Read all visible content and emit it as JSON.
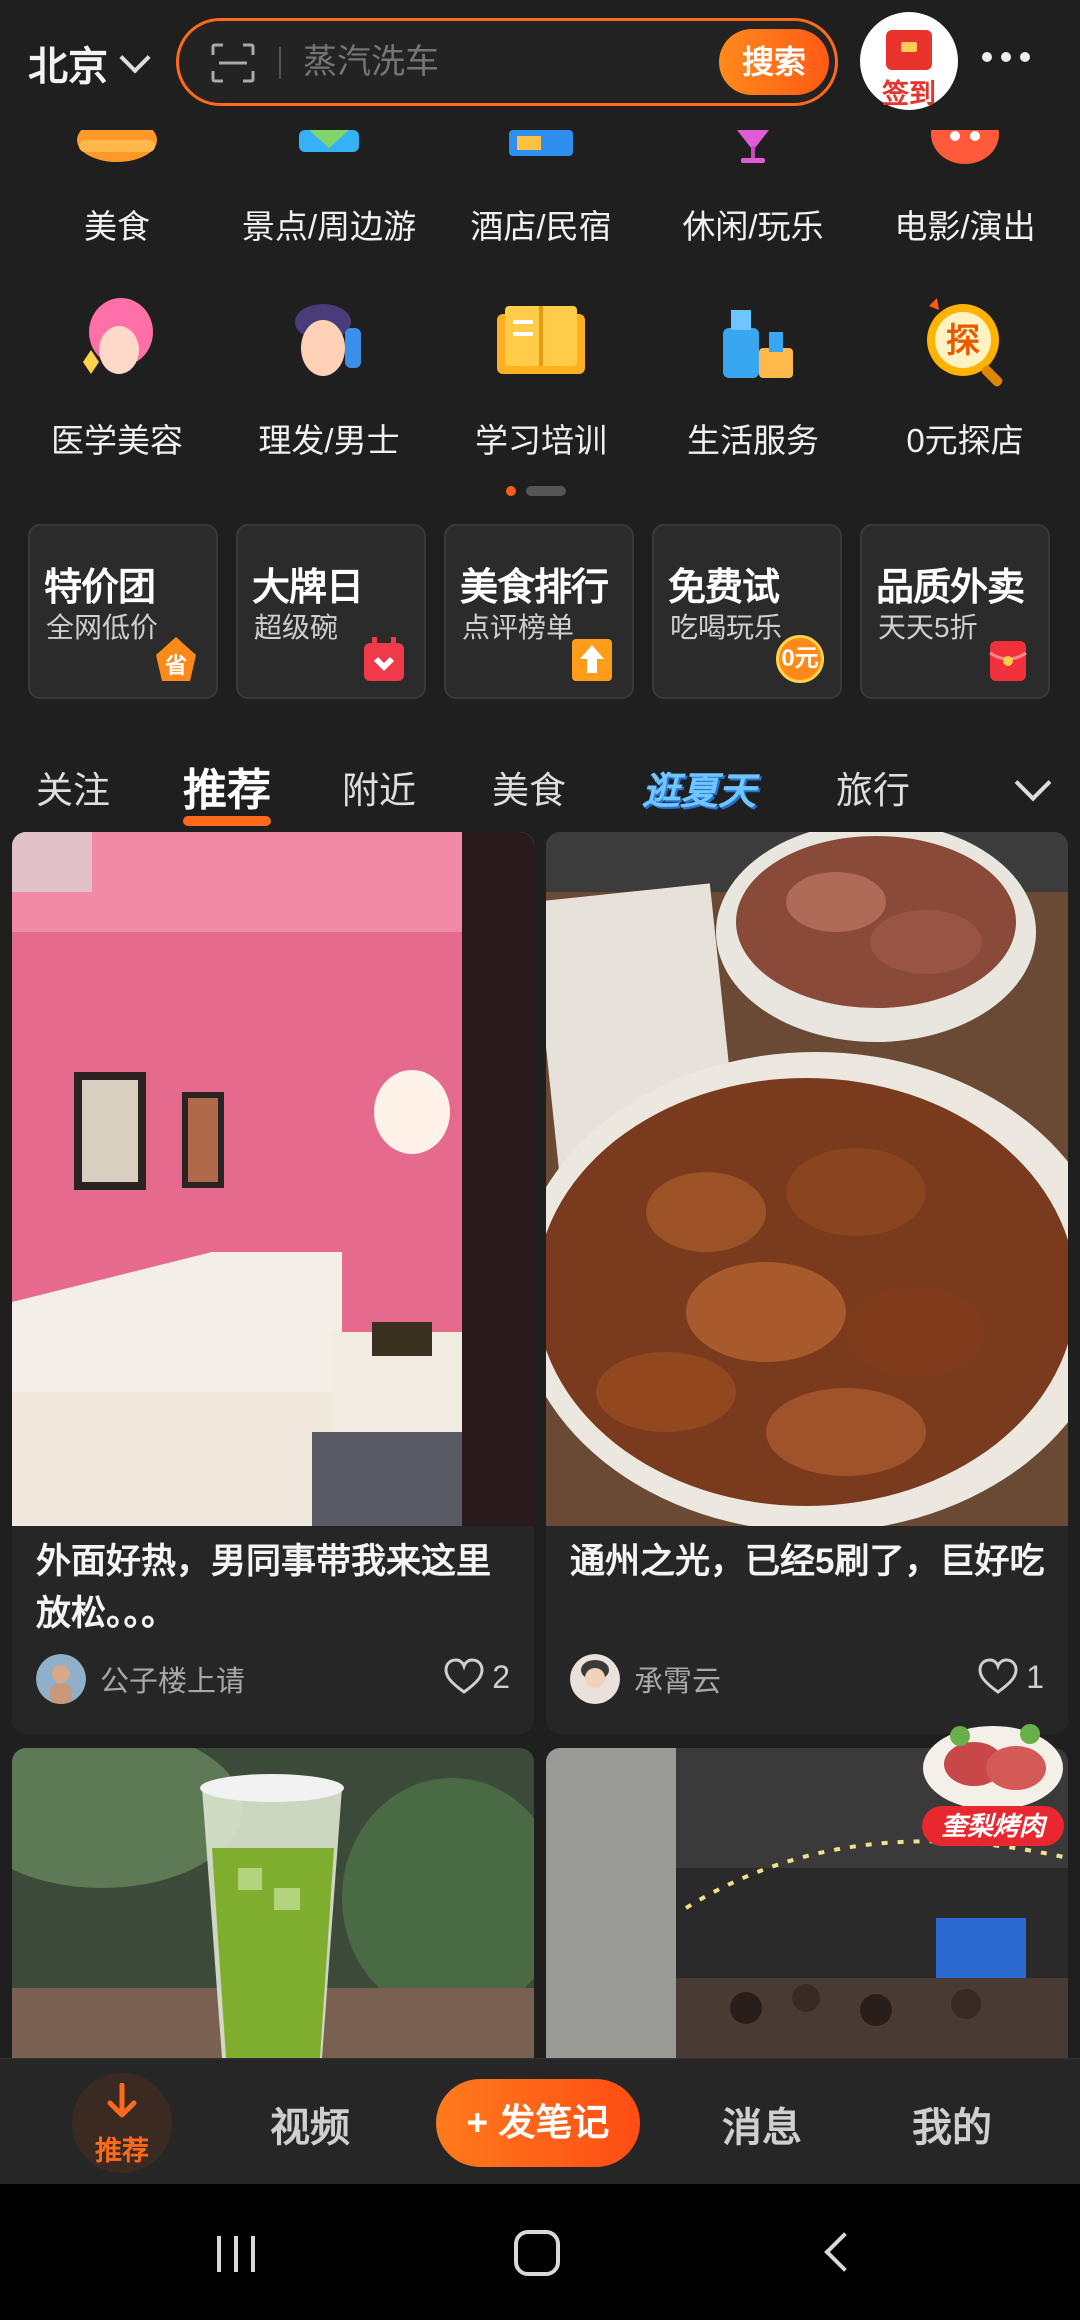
{
  "header": {
    "city": "北京",
    "search_placeholder": "蒸汽洗车",
    "search_button": "搜索",
    "signin_label": "签到"
  },
  "categories": [
    {
      "label": "美食",
      "icon": "roast-chicken-icon"
    },
    {
      "label": "景点/周边游",
      "icon": "scenic-icon"
    },
    {
      "label": "酒店/民宿",
      "icon": "hotel-icon"
    },
    {
      "label": "休闲/玩乐",
      "icon": "cocktail-icon"
    },
    {
      "label": "电影/演出",
      "icon": "movie-icon"
    },
    {
      "label": "医学美容",
      "icon": "beauty-icon"
    },
    {
      "label": "理发/男士",
      "icon": "barber-icon"
    },
    {
      "label": "学习培训",
      "icon": "book-icon"
    },
    {
      "label": "生活服务",
      "icon": "cleaning-icon"
    },
    {
      "label": "0元探店",
      "icon": "explore-icon"
    }
  ],
  "promos": [
    {
      "title": "特价团",
      "subtitle": "全网低价"
    },
    {
      "title": "大牌日",
      "subtitle": "超级碗"
    },
    {
      "title": "美食排行",
      "subtitle": "点评榜单"
    },
    {
      "title": "免费试",
      "subtitle": "吃喝玩乐",
      "badge": "0元"
    },
    {
      "title": "品质外卖",
      "subtitle": "天天5折"
    }
  ],
  "tabs": [
    "关注",
    "推荐",
    "附近",
    "美食",
    "逛夏天",
    "旅行"
  ],
  "active_tab": "推荐",
  "feed": [
    {
      "title": "外面好热，男同事带我来这里放松。。。",
      "author": "公子楼上请",
      "likes": "2"
    },
    {
      "title": "通州之光，已经5刷了，巨好吃",
      "author": "承霄云",
      "likes": "1"
    }
  ],
  "feed_badge": "奎梨烤肉",
  "bottom_nav": {
    "home": "推荐",
    "video": "视频",
    "publish": "+ 发笔记",
    "messages": "消息",
    "me": "我的"
  },
  "colors": {
    "accent": "#ff6a1a",
    "background": "#1f1f1f"
  }
}
